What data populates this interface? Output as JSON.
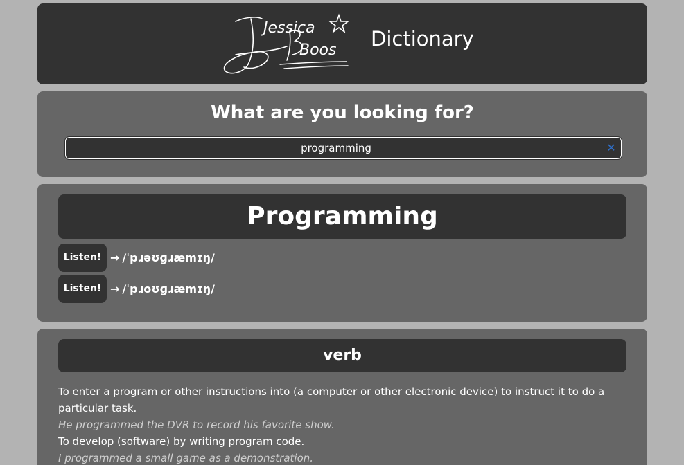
{
  "header": {
    "logo_text_line1": "Jessica",
    "logo_text_line2": "Boos",
    "site_title": "Dictionary"
  },
  "search": {
    "heading": "What are you looking for?",
    "value": "programming",
    "clear_icon": "close-icon"
  },
  "entry": {
    "word": "Programming",
    "phonetics": [
      {
        "button_label": "Listen!",
        "arrow": "→",
        "text": "/ˈpɹəʊɡɹæmɪŋ/"
      },
      {
        "button_label": "Listen!",
        "arrow": "→",
        "text": "/ˈpɹoʊɡɹæmɪŋ/"
      }
    ],
    "meanings": [
      {
        "part_of_speech": "verb",
        "definitions": [
          {
            "definition": "To enter a program or other instructions into (a computer or other electronic device) to instruct it to do a particular task.",
            "example": "He programmed the DVR to record his favorite show."
          },
          {
            "definition": "To develop (software) by writing program code.",
            "example": "I programmed a small game as a demonstration."
          }
        ]
      }
    ]
  },
  "colors": {
    "page_bg": "#b3b3b3",
    "dark_panel": "#323232",
    "mid_panel": "#666666",
    "clear_icon": "#2f6fc9"
  }
}
